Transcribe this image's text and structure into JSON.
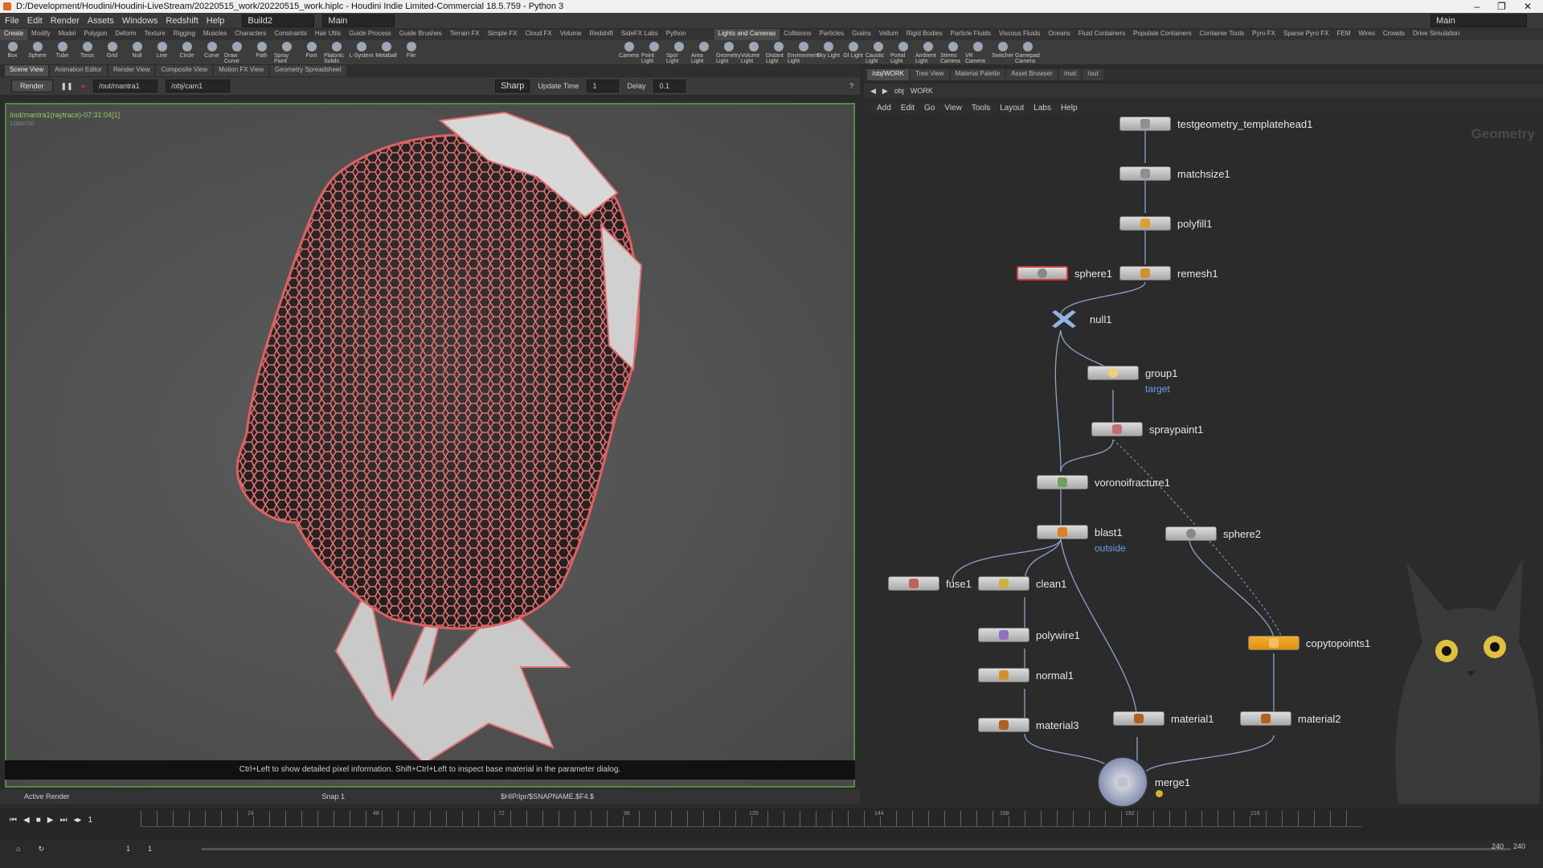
{
  "title": "D:/Development/Houdini/Houdini-LiveStream/20220515_work/20220515_work.hiplc - Houdini Indie Limited-Commercial 18.5.759 - Python 3",
  "menu": [
    "File",
    "Edit",
    "Render",
    "Assets",
    "Windows",
    "Redshift",
    "Help"
  ],
  "desktop": "Build2",
  "main_dd": "Main",
  "main_dd_right": "Main",
  "shelf_tabs_left": [
    "Create",
    "Modify",
    "Model",
    "Polygon",
    "Deform",
    "Texture",
    "Rigging",
    "Muscles",
    "Characters",
    "Constraints",
    "Hair Utils",
    "Guide Process",
    "Guide Brushes",
    "Terrain FX",
    "Simple FX",
    "Cloud FX",
    "Volume",
    "Redshift",
    "SideFX Labs",
    "Python"
  ],
  "shelf_tabs_right": [
    "Lights and Cameras",
    "Collisions",
    "Particles",
    "Grains",
    "Vellum",
    "Rigid Bodies",
    "Particle Fluids",
    "Viscous Fluids",
    "Oceans",
    "Fluid Containers",
    "Populate Containers",
    "Container Tools",
    "Pyro FX",
    "Sparse Pyro FX",
    "FEM",
    "Wires",
    "Crowds",
    "Drive Simulation"
  ],
  "tools_left": [
    "Box",
    "Sphere",
    "Tube",
    "Torus",
    "Grid",
    "Null",
    "Line",
    "Circle",
    "Curve",
    "Draw Curve",
    "Path",
    "Spray Paint",
    "Font",
    "Platonic Solids",
    "L-System",
    "Metaball",
    "File"
  ],
  "tools_right": [
    "Camera",
    "Point Light",
    "Spot Light",
    "Area Light",
    "Geometry Light",
    "Volume Light",
    "Distant Light",
    "Environment Light",
    "Sky Light",
    "GI Light",
    "Caustic Light",
    "Portal Light",
    "Ambient Light",
    "Stereo Camera",
    "VR Camera",
    "Switcher",
    "Gamepad Camera"
  ],
  "pane_tabs_left": [
    "Scene View",
    "Animation Editor",
    "Render View",
    "Composite View",
    "Motion FX View",
    "Geometry Spreadsheet"
  ],
  "pane_tabs_right": [
    "/obj/WORK",
    "Tree View",
    "Material Palette",
    "Asset Browser",
    "/mat",
    "/out"
  ],
  "viewport": {
    "render_btn": "Render",
    "out_path": "/out/mantra1",
    "cam_path": "/obj/cam1",
    "sharp": "Sharp",
    "update_time_label": "Update Time",
    "update_time": "1",
    "delay_label": "Delay",
    "delay": "0.1",
    "render_info": "/out/mantra1(raytrace)-07:31:04[1]",
    "res": "1280x720",
    "hint": "Ctrl+Left to show detailed pixel information. Shift+Ctrl+Left to inspect base material in the parameter dialog.",
    "active_render": "Active Render",
    "snap": "Snap 1",
    "ipr_path": "$HIP/ipr/$SNAPNAME.$F4.$"
  },
  "network": {
    "path_obj": "obj",
    "path_work": "WORK",
    "menu": [
      "Add",
      "Edit",
      "Go",
      "View",
      "Tools",
      "Layout",
      "Labs",
      "Help"
    ],
    "context": "Geometry",
    "nodes": {
      "testgeo": "testgeometry_templatehead1",
      "matchsize": "matchsize1",
      "polyfill": "polyfill1",
      "sphere1": "sphere1",
      "remesh": "remesh1",
      "null": "null1",
      "group": "group1",
      "group_comment": "target",
      "spraypaint": "spraypaint1",
      "voronoi": "voronoifracture1",
      "blast": "blast1",
      "blast_comment": "outside",
      "sphere2": "sphere2",
      "fuse": "fuse1",
      "clean": "clean1",
      "polywire": "polywire1",
      "normal": "normal1",
      "material3": "material3",
      "material1": "material1",
      "material2": "material2",
      "copytopoints": "copytopoints1",
      "merge": "merge1"
    }
  },
  "timeline": {
    "frame": "1",
    "ticks": [
      "24",
      "48",
      "72",
      "96",
      "120",
      "144",
      "168",
      "192",
      "216"
    ],
    "start": "1",
    "start2": "1",
    "end": "240",
    "end2": "240"
  },
  "colors": {
    "selected": "#d04040",
    "orange": "#f0a020",
    "comment": "#6aa0e8",
    "green_border": "#4f8f3a"
  }
}
